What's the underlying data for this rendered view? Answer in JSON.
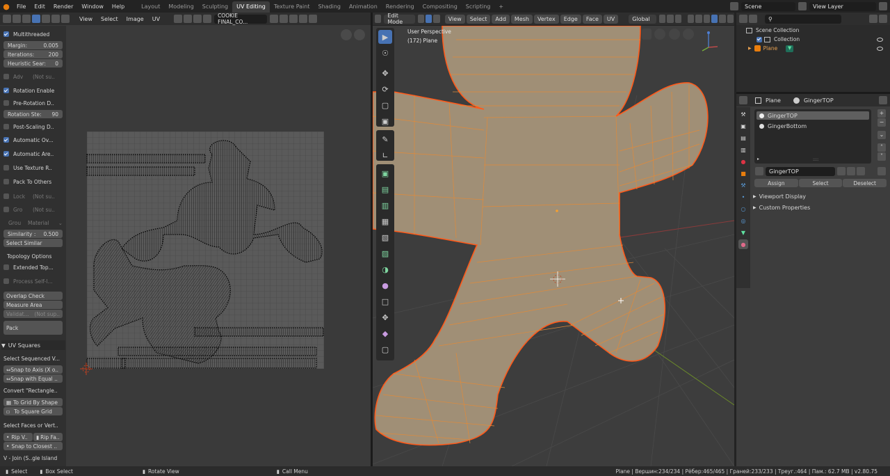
{
  "topbar": {
    "menus": [
      "File",
      "Edit",
      "Render",
      "Window",
      "Help"
    ],
    "workspaces": [
      "Layout",
      "Modeling",
      "Sculpting",
      "UV Editing",
      "Texture Paint",
      "Shading",
      "Animation",
      "Rendering",
      "Compositing",
      "Scripting"
    ],
    "active_workspace": "UV Editing",
    "scene": "Scene",
    "view_layer": "View Layer"
  },
  "uv_header": {
    "menus": [
      "View",
      "Select",
      "Image",
      "UV"
    ],
    "image_name": "COOKIE FINAL_CO..."
  },
  "n_panel": {
    "multithreaded": "Multithreaded",
    "margin_label": "Margin:",
    "margin_value": "0.005",
    "iterations_label": "Iterations:",
    "iterations_value": "200",
    "heuristic_label": "Heuristic Sear:",
    "heuristic_value": "0",
    "adv": "Adv",
    "adv_note": "(Not su..",
    "rotation_enable": "Rotation Enable",
    "pre_rotation": "Pre-Rotation D..",
    "rotation_step_label": "Rotation Ste:",
    "rotation_step_value": "90",
    "post_scaling": "Post-Scaling D..",
    "automatic_ov": "Automatic Ov...",
    "automatic_are": "Automatic Are..",
    "use_texture": "Use Texture R..",
    "pack_to_others": "Pack To Others",
    "lock": "Lock",
    "lock_note": "(Not su..",
    "gro": "Gro",
    "gro_note": "(Not su..",
    "grou": "Grou",
    "grou_value": "Material",
    "similarity_label": "Similarity :",
    "similarity_value": "0.500",
    "select_similar": "Select Similar",
    "topology_options": "Topology Options",
    "extended_top": "Extended Top...",
    "process_self": "Process Self-I...",
    "overlap_check": "Overlap Check",
    "measure_area": "Measure Area",
    "validat": "Validat...",
    "validat_note": "(Not sup..",
    "pack": "Pack",
    "uv_squares": "UV Squares",
    "select_sequenced": "Select Sequenced V...",
    "snap_axis": "⇔Snap to Axis (X o..",
    "snap_equal": "⇔Snap with Equal ..",
    "convert_rect": "Convert \"Rectangle..",
    "to_grid_by_shape": "To Grid By Shape",
    "to_square_grid": "To Square Grid",
    "select_faces": "Select Faces or Vert..",
    "rip_v": "Rip V..",
    "rip_fa": "Rip Fa..",
    "snap_closest": "Snap to Closest ..",
    "join": "V - Join (S..gle Island"
  },
  "viewport_header": {
    "mode": "Edit Mode",
    "menus": [
      "View",
      "Select",
      "Add",
      "Mesh",
      "Vertex",
      "Edge",
      "Face",
      "UV"
    ],
    "orientation": "Global"
  },
  "viewport": {
    "perspective": "User Perspective",
    "object_info": "(172) Plane"
  },
  "outliner": {
    "scene_collection": "Scene Collection",
    "collection": "Collection",
    "plane": "Plane"
  },
  "properties": {
    "object": "Plane",
    "material": "GingerTOP",
    "slots": [
      "GingerTOP",
      "GingerBottom"
    ],
    "material_field": "GingerTOP",
    "assign": "Assign",
    "select": "Select",
    "deselect": "Deselect",
    "viewport_display": "Viewport Display",
    "custom_properties": "Custom Properties"
  },
  "status": {
    "select": "Select",
    "box_select": "Box Select",
    "rotate_view": "Rotate View",
    "call_menu": "Call Menu",
    "stats": "Plane | Вершин:234/234 | Рёбер:465/465 | Граней:233/233 | Треуг.:464 | Пам.: 62.7 MB | v2.80.75"
  },
  "colors": {
    "accent": "#4772b3",
    "mesh_fill": "#a08f76",
    "selected_edge": "#ff6a1a",
    "orange": "#e87d0d"
  }
}
